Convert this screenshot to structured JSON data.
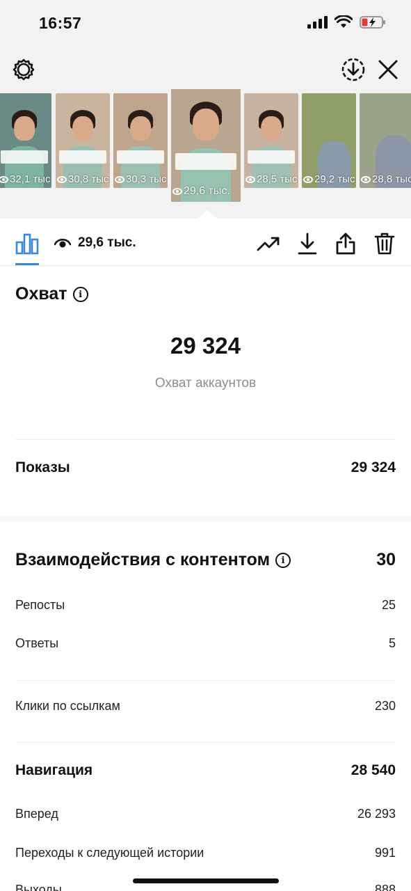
{
  "status_bar": {
    "time": "16:57"
  },
  "stories": [
    {
      "views": "32,1 тыс",
      "bg": "#6a8a86",
      "body": "#7fb3a1"
    },
    {
      "views": "30,8 тыс",
      "bg": "#c9b49d",
      "body": "#9bbfae"
    },
    {
      "views": "30,3 тыс",
      "bg": "#bfa58c",
      "body": "#9cc0af"
    },
    {
      "views": "29,6 тыс.",
      "bg": "#b9a690",
      "body": "#96c2b0",
      "active": true
    },
    {
      "views": "28,5 тыс",
      "bg": "#c7b39f",
      "body": "#9fc1b2"
    },
    {
      "views": "29,2 тыс",
      "bg": "#8f9f6a",
      "body": "#8a9aa8"
    },
    {
      "views": "28,8 тыс",
      "bg": "#9aa48a",
      "body": "#8d96a4"
    }
  ],
  "action_bar": {
    "views_value": "29,6 тыс."
  },
  "reach": {
    "title": "Охват",
    "value": "29 324",
    "caption": "Охват аккаунтов"
  },
  "impressions": {
    "label": "Показы",
    "value": "29 324"
  },
  "interactions": {
    "title": "Взаимодействия с контентом",
    "value": "30",
    "items": [
      {
        "label": "Репосты",
        "value": "25"
      },
      {
        "label": "Ответы",
        "value": "5"
      }
    ]
  },
  "link_clicks": {
    "label": "Клики по ссылкам",
    "value": "230"
  },
  "navigation": {
    "title": "Навигация",
    "value": "28 540",
    "items": [
      {
        "label": "Вперед",
        "value": "26 293"
      },
      {
        "label": "Переходы к следующей истории",
        "value": "991"
      },
      {
        "label": "Выходы",
        "value": "888"
      }
    ]
  },
  "colors": {
    "accent": "#3b87e0",
    "muted": "#8e8e8e"
  },
  "icons": [
    "settings-icon",
    "download-circle-icon",
    "close-icon",
    "insights-chart-icon",
    "eye-icon",
    "trending-icon",
    "download-icon",
    "share-icon",
    "trash-icon"
  ]
}
